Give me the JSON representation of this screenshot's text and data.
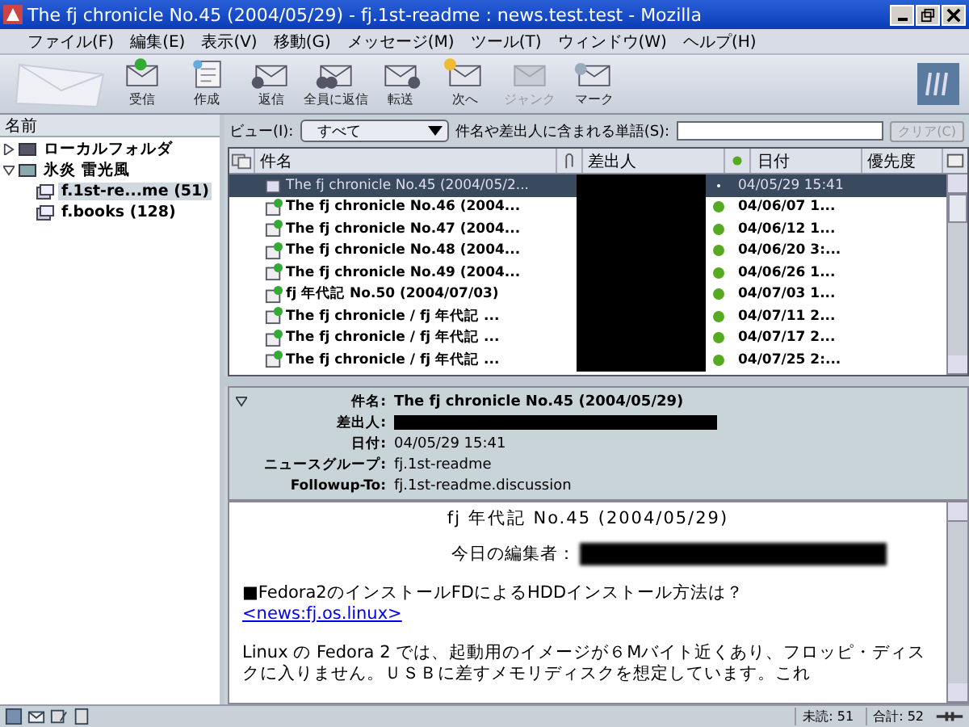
{
  "window": {
    "title": "The fj chronicle No.45 (2004/05/29) - fj.1st-readme : news.test.test - Mozilla"
  },
  "menu": [
    "ファイル(F)",
    "編集(E)",
    "表示(V)",
    "移動(G)",
    "メッセージ(M)",
    "ツール(T)",
    "ウィンドウ(W)",
    "ヘルプ(H)"
  ],
  "toolbar": [
    {
      "kind": "get",
      "label": "受信",
      "disabled": false
    },
    {
      "kind": "compose",
      "label": "作成",
      "disabled": false
    },
    {
      "kind": "reply",
      "label": "返信",
      "disabled": false
    },
    {
      "kind": "replyall",
      "label": "全員に返信",
      "disabled": false
    },
    {
      "kind": "forward",
      "label": "転送",
      "disabled": false
    },
    {
      "kind": "next",
      "label": "次へ",
      "disabled": false
    },
    {
      "kind": "junk",
      "label": "ジャンク",
      "disabled": true
    },
    {
      "kind": "mark",
      "label": "マーク",
      "disabled": false
    }
  ],
  "folder_pane": {
    "header": "名前",
    "tree": [
      {
        "label": "ローカルフォルダ",
        "kind": "local",
        "expanded": false,
        "selected": false
      },
      {
        "label": "氷炎 雷光風",
        "kind": "server",
        "expanded": true,
        "selected": false,
        "children": [
          {
            "label": "f.1st-re...me (51)",
            "kind": "group",
            "selected": true
          },
          {
            "label": "f.books (128)",
            "kind": "group",
            "selected": false
          }
        ]
      }
    ]
  },
  "view_bar": {
    "label": "ビュー(I):",
    "view": "すべて",
    "search_label": "件名や差出人に含まれる単語(S):",
    "clear_button": "クリア(C)"
  },
  "thread_pane": {
    "columns": [
      "件名",
      "差出人",
      "日付",
      "優先度"
    ],
    "rows": [
      {
        "subject": "The fj chronicle No.45 (2004/05/2...",
        "date": "04/05/29 15:41",
        "unread": false,
        "selected": true
      },
      {
        "subject": "The fj chronicle No.46 (2004...",
        "date": "04/06/07 1...",
        "unread": true,
        "selected": false
      },
      {
        "subject": "The fj chronicle No.47 (2004...",
        "date": "04/06/12 1...",
        "unread": true,
        "selected": false
      },
      {
        "subject": "The fj chronicle No.48 (2004...",
        "date": "04/06/20 3:...",
        "unread": true,
        "selected": false
      },
      {
        "subject": "The fj chronicle No.49 (2004...",
        "date": "04/06/26 1...",
        "unread": true,
        "selected": false
      },
      {
        "subject": "fj 年代記 No.50 (2004/07/03)",
        "date": "04/07/03 1...",
        "unread": true,
        "selected": false
      },
      {
        "subject": "The fj chronicle / fj 年代記 ...",
        "date": "04/07/11 2...",
        "unread": true,
        "selected": false
      },
      {
        "subject": "The fj chronicle / fj 年代記 ...",
        "date": "04/07/17 2...",
        "unread": true,
        "selected": false
      },
      {
        "subject": "The fj chronicle / fj 年代記 ...",
        "date": "04/07/25 2:...",
        "unread": true,
        "selected": false
      }
    ]
  },
  "message_header": {
    "fields": [
      {
        "label": "件名:",
        "value": "The fj chronicle No.45 (2004/05/29)",
        "kind": "bold"
      },
      {
        "label": "差出人:",
        "kind": "redacted"
      },
      {
        "label": "日付:",
        "value": "04/05/29 15:41",
        "kind": "plain"
      },
      {
        "label": "ニュースグループ:",
        "value": "fj.1st-readme",
        "kind": "plain"
      },
      {
        "label": "Followup-To:",
        "value": "fj.1st-readme.discussion",
        "kind": "plain"
      }
    ]
  },
  "message_body": [
    {
      "kind": "center",
      "text": "fj 年代記 No.45 (2004/05/29)"
    },
    {
      "kind": "editor",
      "text": "今日の編集者："
    },
    {
      "kind": "heading",
      "text": "■Fedora2のインストールFDによるHDDインストール方法は？"
    },
    {
      "kind": "link",
      "text": "<news:fj.os.linux>"
    },
    {
      "kind": "para",
      "text": "Linux の Fedora 2 では、起動用のイメージが６Mバイト近くあり、フロッピ・ディスクに入りません。ＵＳＢに差すメモリディスクを想定しています。これ"
    }
  ],
  "status_bar": {
    "unread": "未読: 51",
    "total": "合計: 52"
  }
}
